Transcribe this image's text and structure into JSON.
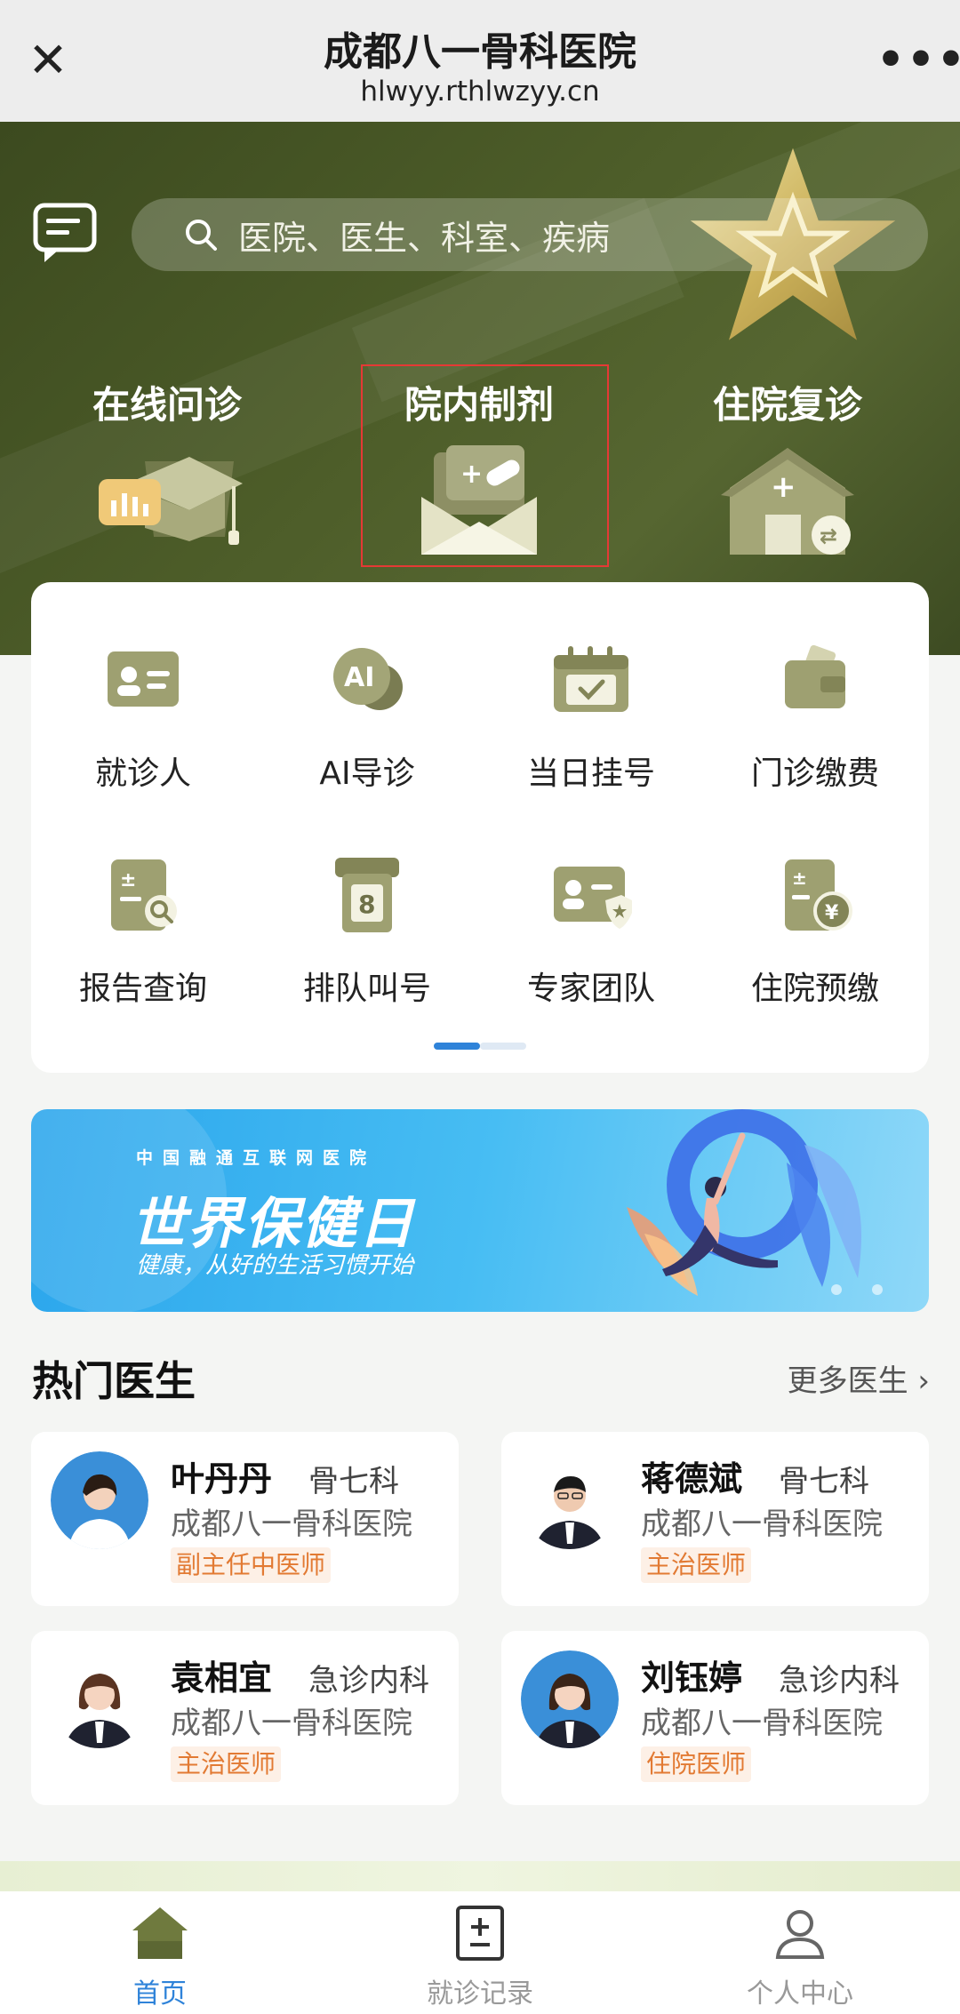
{
  "titlebar": {
    "close_icon": "close-icon",
    "title": "成都八一骨科医院",
    "url": "hlwyy.rthlwzyy.cn",
    "more": "•••"
  },
  "hero": {
    "search_placeholder": "医院、医生、科室、疾病",
    "items": [
      {
        "label": "在线问诊",
        "icon": "online-consult-icon"
      },
      {
        "label": "院内制剂",
        "icon": "in-hospital-preparation-icon",
        "highlighted": true
      },
      {
        "label": "住院复诊",
        "icon": "inpatient-revisit-icon"
      }
    ],
    "colors": {
      "bg": "#4d5d29",
      "highlight_border": "#e53935"
    }
  },
  "grid": {
    "items": [
      {
        "label": "就诊人",
        "icon": "patient-card-icon"
      },
      {
        "label": "AI导诊",
        "icon": "ai-guide-icon"
      },
      {
        "label": "当日挂号",
        "icon": "calendar-check-icon"
      },
      {
        "label": "门诊缴费",
        "icon": "wallet-icon"
      },
      {
        "label": "报告查询",
        "icon": "report-search-icon"
      },
      {
        "label": "排队叫号",
        "icon": "queue-number-icon"
      },
      {
        "label": "专家团队",
        "icon": "expert-team-icon"
      },
      {
        "label": "住院预缴",
        "icon": "prepay-icon"
      }
    ],
    "queue_number": "8",
    "page_indicator": {
      "pages": 2,
      "active": 1
    }
  },
  "banner": {
    "small_text": "中国融通互联网医院",
    "title": "世界保健日",
    "subtitle": "健康，从好的生活习惯开始",
    "dots": 2
  },
  "doctors": {
    "section_title": "热门医生",
    "more_link": "更多医生 ›",
    "list": [
      {
        "name": "叶丹丹",
        "dept": "骨七科",
        "hospital": "成都八一骨科医院",
        "title": "副主任中医师"
      },
      {
        "name": "蒋德斌",
        "dept": "骨七科",
        "hospital": "成都八一骨科医院",
        "title": "主治医师"
      },
      {
        "name": "袁相宜",
        "dept": "急诊内科",
        "hospital": "成都八一骨科医院",
        "title": "主治医师"
      },
      {
        "name": "刘钰婷",
        "dept": "急诊内科",
        "hospital": "成都八一骨科医院",
        "title": "住院医师"
      }
    ]
  },
  "bottom_nav": {
    "items": [
      {
        "label": "首页",
        "icon": "home-icon",
        "active": true
      },
      {
        "label": "就诊记录",
        "icon": "records-icon",
        "active": false
      },
      {
        "label": "个人中心",
        "icon": "profile-icon",
        "active": false
      }
    ],
    "active_color": "#2f83d9"
  }
}
